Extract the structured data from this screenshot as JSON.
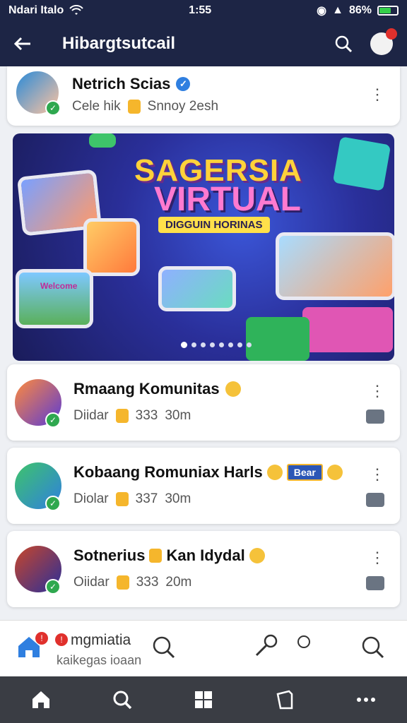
{
  "status_bar": {
    "carrier": "Ndari Italo",
    "time": "1:55",
    "battery": "86%"
  },
  "app_bar": {
    "title": "Hibargtsutcail"
  },
  "profile": {
    "name": "Netrich Scias",
    "meta_left": "Cele hik",
    "meta_right": "Snnoy 2esh"
  },
  "banner": {
    "title": "SAGERSIA",
    "subtitle": "VIRTUAL",
    "tagline": "DIGGUIN HORINAS",
    "screen_sign": "Welcome"
  },
  "posts": [
    {
      "name": "Rmaang Komunitas",
      "author": "Diidar",
      "count": "333",
      "time": "30m"
    },
    {
      "name": "Kobaang Romuniax Harls",
      "author": "Diolar",
      "count": "337",
      "time": "30m",
      "badge": "Bear"
    },
    {
      "name": "Sotnerius",
      "name_after": "Kan Idydal",
      "author": "Oiidar",
      "count": "333",
      "time": "20m"
    }
  ],
  "footer": {
    "line1": "mgmiatia",
    "line2": "kaikegas ioaan"
  },
  "colors": {
    "header_bg": "#1d2545",
    "nav_bg": "#3a3d44",
    "verified": "#2f7fe0",
    "badge_green": "#2fa84f",
    "accent_red": "#e0302c",
    "coin": "#f5b62c"
  },
  "icons": [
    "back-arrow-icon",
    "search-icon",
    "verified-icon",
    "coin-icon",
    "kebab-menu-icon",
    "share-icon",
    "home-icon",
    "grid-icon",
    "book-icon",
    "more-icon",
    "pen-icon",
    "magnifier-icon"
  ]
}
